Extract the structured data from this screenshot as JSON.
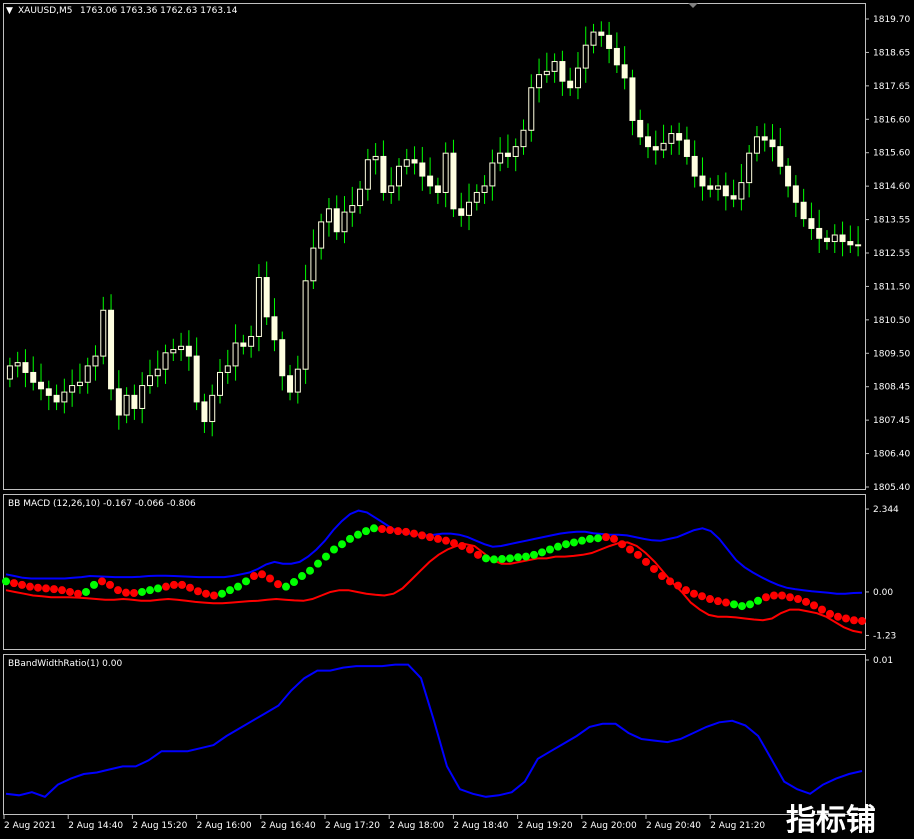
{
  "window": {
    "symbol_title": "XAUUSD,M5",
    "ohlc": "1763.06 1763.36 1762.63 1763.14",
    "menu_glyph": "▼"
  },
  "colors": {
    "background": "#000000",
    "frame": "#c0c0c0",
    "candle_up_fill": "#000000",
    "candle_body": "#ffffe0",
    "candle_wick": "#00ff00",
    "macd_upper": "#0000ff",
    "macd_lower": "#ff0000",
    "dot_up": "#00ff00",
    "dot_down": "#ff0000",
    "ratio_line": "#0000ff"
  },
  "main_panel": {
    "price_labels": [
      "1819.70",
      "1818.65",
      "1817.65",
      "1816.60",
      "1815.60",
      "1814.60",
      "1813.55",
      "1812.55",
      "1811.50",
      "1810.50",
      "1809.50",
      "1808.45",
      "1807.45",
      "1806.40",
      "1805.40"
    ]
  },
  "macd_panel": {
    "title": "BB MACD (12,26,10) -0.167 -0.066 -0.806",
    "scale_labels": [
      "2.344",
      "0.00",
      "-1.23"
    ]
  },
  "ratio_panel": {
    "title": "BBandWidthRatio(1) 0.00",
    "scale_labels": [
      "0.01"
    ]
  },
  "time_axis": {
    "labels": [
      "2 Aug 2021",
      "2 Aug 14:40",
      "2 Aug 15:20",
      "2 Aug 16:00",
      "2 Aug 16:40",
      "2 Aug 17:20",
      "2 Aug 18:00",
      "2 Aug 18:40",
      "2 Aug 19:20",
      "2 Aug 20:00",
      "2 Aug 20:40",
      "2 Aug 21:20"
    ]
  },
  "watermark": {
    "text": "指标铺"
  },
  "chart_data": {
    "type": "line",
    "main": {
      "type": "candlestick",
      "ylim": [
        1805.4,
        1819.7
      ],
      "close": [
        1809.1,
        1809.2,
        1808.9,
        1808.6,
        1808.4,
        1808.2,
        1808.0,
        1808.3,
        1808.5,
        1808.6,
        1809.1,
        1809.4,
        1810.8,
        1808.4,
        1807.6,
        1808.2,
        1807.8,
        1808.5,
        1808.8,
        1809.0,
        1809.5,
        1809.6,
        1809.7,
        1809.4,
        1808.0,
        1807.4,
        1808.2,
        1808.9,
        1809.1,
        1809.8,
        1809.7,
        1810.0,
        1811.8,
        1810.6,
        1809.9,
        1808.8,
        1808.3,
        1809.0,
        1811.7,
        1812.7,
        1813.5,
        1813.9,
        1813.2,
        1813.8,
        1814.0,
        1814.5,
        1815.4,
        1815.5,
        1814.4,
        1814.6,
        1815.2,
        1815.4,
        1815.3,
        1814.9,
        1814.6,
        1814.4,
        1815.6,
        1813.9,
        1813.7,
        1814.1,
        1814.4,
        1814.6,
        1815.3,
        1815.6,
        1815.5,
        1815.8,
        1816.3,
        1817.6,
        1818.0,
        1818.1,
        1818.4,
        1817.8,
        1817.6,
        1818.2,
        1818.9,
        1819.3,
        1819.2,
        1818.8,
        1818.3,
        1817.9,
        1816.6,
        1816.1,
        1815.8,
        1815.7,
        1815.9,
        1816.2,
        1816.0,
        1815.5,
        1814.9,
        1814.6,
        1814.5,
        1814.6,
        1814.3,
        1814.2,
        1814.7,
        1815.6,
        1816.1,
        1816.0,
        1815.8,
        1815.2,
        1814.6,
        1814.1,
        1813.6,
        1813.3,
        1813.0,
        1812.9,
        1813.1,
        1812.9,
        1812.8,
        1812.8
      ],
      "open": [
        1808.7,
        1809.1,
        1809.2,
        1808.9,
        1808.6,
        1808.4,
        1808.2,
        1808.0,
        1808.3,
        1808.5,
        1808.6,
        1809.1,
        1809.4,
        1810.8,
        1808.4,
        1807.6,
        1808.2,
        1807.8,
        1808.5,
        1808.8,
        1809.0,
        1809.5,
        1809.6,
        1809.7,
        1809.4,
        1808.0,
        1807.4,
        1808.2,
        1808.9,
        1809.1,
        1809.8,
        1809.7,
        1810.0,
        1811.8,
        1810.6,
        1809.9,
        1808.8,
        1808.3,
        1809.0,
        1811.7,
        1812.7,
        1813.5,
        1813.9,
        1813.2,
        1813.8,
        1814.0,
        1814.5,
        1815.4,
        1815.5,
        1814.4,
        1814.6,
        1815.2,
        1815.4,
        1815.3,
        1814.9,
        1814.6,
        1814.4,
        1815.6,
        1813.9,
        1813.7,
        1814.1,
        1814.4,
        1814.6,
        1815.3,
        1815.6,
        1815.5,
        1815.8,
        1816.3,
        1817.6,
        1818.0,
        1818.1,
        1818.4,
        1817.8,
        1817.6,
        1818.2,
        1818.9,
        1819.3,
        1819.2,
        1818.8,
        1818.3,
        1817.9,
        1816.6,
        1816.1,
        1815.8,
        1815.7,
        1815.9,
        1816.2,
        1816.0,
        1815.5,
        1814.9,
        1814.6,
        1814.5,
        1814.6,
        1814.3,
        1814.2,
        1814.7,
        1815.6,
        1816.1,
        1816.0,
        1815.8,
        1815.2,
        1814.6,
        1814.1,
        1813.6,
        1813.3,
        1813.0,
        1812.9,
        1813.1,
        1812.9,
        1812.8
      ]
    },
    "macd": {
      "ylim": [
        -1.5,
        2.6
      ],
      "upper": [
        0.5,
        0.45,
        0.4,
        0.38,
        0.38,
        0.38,
        0.38,
        0.38,
        0.4,
        0.42,
        0.45,
        0.44,
        0.43,
        0.42,
        0.42,
        0.42,
        0.43,
        0.45,
        0.46,
        0.46,
        0.45,
        0.44,
        0.43,
        0.42,
        0.42,
        0.42,
        0.42,
        0.45,
        0.5,
        0.55,
        0.65,
        0.78,
        0.85,
        0.8,
        0.8,
        0.85,
        1.0,
        1.2,
        1.45,
        1.75,
        2.0,
        2.2,
        2.3,
        2.25,
        2.1,
        1.95,
        1.8,
        1.7,
        1.65,
        1.62,
        1.6,
        1.62,
        1.65,
        1.65,
        1.62,
        1.55,
        1.45,
        1.35,
        1.28,
        1.3,
        1.35,
        1.4,
        1.45,
        1.5,
        1.55,
        1.6,
        1.65,
        1.68,
        1.7,
        1.7,
        1.66,
        1.64,
        1.62,
        1.62,
        1.6,
        1.55,
        1.5,
        1.46,
        1.45,
        1.5,
        1.55,
        1.65,
        1.75,
        1.8,
        1.72,
        1.5,
        1.2,
        0.9,
        0.7,
        0.55,
        0.42,
        0.3,
        0.2,
        0.12,
        0.08,
        0.05,
        0.02,
        0.0,
        -0.02,
        -0.05,
        -0.05,
        -0.03,
        -0.02
      ],
      "lower": [
        0.05,
        0.0,
        -0.05,
        -0.1,
        -0.12,
        -0.15,
        -0.15,
        -0.15,
        -0.16,
        -0.18,
        -0.2,
        -0.22,
        -0.22,
        -0.2,
        -0.22,
        -0.25,
        -0.25,
        -0.22,
        -0.2,
        -0.22,
        -0.25,
        -0.28,
        -0.3,
        -0.32,
        -0.32,
        -0.3,
        -0.28,
        -0.26,
        -0.25,
        -0.22,
        -0.2,
        -0.22,
        -0.24,
        -0.25,
        -0.2,
        -0.1,
        0.0,
        0.05,
        0.05,
        0.0,
        -0.05,
        -0.08,
        -0.1,
        -0.05,
        0.1,
        0.35,
        0.6,
        0.85,
        1.05,
        1.2,
        1.3,
        1.35,
        1.3,
        1.1,
        0.9,
        0.8,
        0.8,
        0.85,
        0.9,
        0.95,
        0.95,
        1.0,
        1.0,
        1.02,
        1.05,
        1.1,
        1.2,
        1.3,
        1.38,
        1.4,
        1.3,
        1.1,
        0.85,
        0.55,
        0.25,
        0.0,
        -0.3,
        -0.5,
        -0.65,
        -0.7,
        -0.7,
        -0.72,
        -0.75,
        -0.78,
        -0.8,
        -0.75,
        -0.6,
        -0.5,
        -0.5,
        -0.55,
        -0.6,
        -0.7,
        -0.85,
        -1.0,
        -1.1,
        -1.15
      ],
      "dots": [
        0.3,
        0.25,
        0.2,
        0.15,
        0.12,
        0.1,
        0.08,
        0.05,
        0.0,
        -0.05,
        0.0,
        0.2,
        0.3,
        0.2,
        0.05,
        -0.02,
        -0.03,
        0.0,
        0.05,
        0.1,
        0.15,
        0.2,
        0.2,
        0.12,
        0.02,
        -0.05,
        -0.1,
        -0.05,
        0.05,
        0.15,
        0.3,
        0.45,
        0.5,
        0.38,
        0.22,
        0.15,
        0.28,
        0.45,
        0.6,
        0.8,
        1.0,
        1.2,
        1.35,
        1.5,
        1.62,
        1.72,
        1.8,
        1.78,
        1.75,
        1.72,
        1.7,
        1.65,
        1.6,
        1.55,
        1.5,
        1.45,
        1.38,
        1.3,
        1.2,
        1.05,
        0.95,
        0.92,
        0.93,
        0.95,
        0.98,
        1.0,
        1.05,
        1.12,
        1.2,
        1.28,
        1.35,
        1.4,
        1.45,
        1.5,
        1.52,
        1.55,
        1.5,
        1.35,
        1.2,
        1.05,
        0.85,
        0.65,
        0.45,
        0.3,
        0.18,
        0.05,
        -0.05,
        -0.12,
        -0.2,
        -0.26,
        -0.3,
        -0.35,
        -0.4,
        -0.35,
        -0.25,
        -0.15,
        -0.1,
        -0.1,
        -0.15,
        -0.2,
        -0.28,
        -0.38,
        -0.5,
        -0.62,
        -0.7,
        -0.75,
        -0.8,
        -0.82
      ],
      "dot_up": [
        1,
        0,
        0,
        0,
        0,
        0,
        0,
        0,
        0,
        0,
        1,
        1,
        0,
        0,
        0,
        0,
        0,
        1,
        1,
        1,
        0,
        0,
        0,
        0,
        0,
        0,
        0,
        1,
        1,
        1,
        1,
        0,
        0,
        0,
        0,
        1,
        1,
        1,
        1,
        1,
        1,
        1,
        1,
        1,
        1,
        1,
        1,
        0,
        0,
        0,
        0,
        0,
        0,
        0,
        0,
        0,
        0,
        0,
        0,
        0,
        1,
        1,
        1,
        1,
        1,
        1,
        1,
        1,
        1,
        1,
        1,
        1,
        1,
        1,
        1,
        0,
        0,
        0,
        0,
        0,
        0,
        0,
        0,
        0,
        0,
        0,
        0,
        0,
        0,
        0,
        0,
        1,
        1,
        1,
        1,
        0,
        0,
        0,
        0,
        0,
        0,
        0,
        0,
        0,
        0,
        0,
        0
      ]
    },
    "ratio": {
      "ylim": [
        0,
        0.01
      ],
      "values": [
        0.0012,
        0.0011,
        0.0013,
        0.001,
        0.0018,
        0.0022,
        0.0025,
        0.0026,
        0.0028,
        0.003,
        0.003,
        0.0034,
        0.004,
        0.004,
        0.004,
        0.0042,
        0.0044,
        0.005,
        0.0055,
        0.006,
        0.0065,
        0.007,
        0.008,
        0.0088,
        0.0093,
        0.0093,
        0.0095,
        0.0096,
        0.0096,
        0.0096,
        0.0097,
        0.0097,
        0.0088,
        0.006,
        0.003,
        0.0015,
        0.0012,
        0.001,
        0.0011,
        0.0013,
        0.002,
        0.0035,
        0.004,
        0.0045,
        0.005,
        0.0056,
        0.0058,
        0.0058,
        0.0052,
        0.0048,
        0.0047,
        0.0046,
        0.0048,
        0.0052,
        0.0056,
        0.0059,
        0.006,
        0.0057,
        0.005,
        0.0035,
        0.002,
        0.0015,
        0.0012,
        0.0018,
        0.0022,
        0.0025,
        0.0027
      ]
    }
  }
}
